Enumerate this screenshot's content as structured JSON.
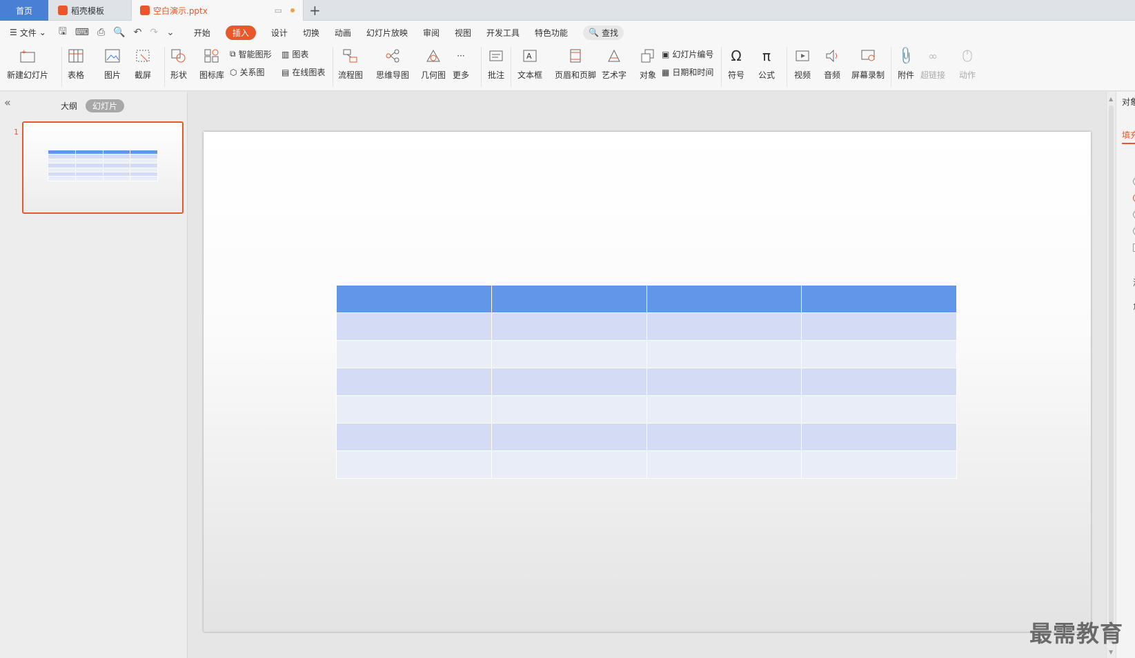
{
  "tabs": {
    "home": "首页",
    "template": "稻壳模板",
    "doc": "空白演示.pptx"
  },
  "menubar": {
    "file": "文件",
    "items": [
      "开始",
      "插入",
      "设计",
      "切换",
      "动画",
      "幻灯片放映",
      "审阅",
      "视图",
      "开发工具",
      "特色功能"
    ],
    "active": "插入",
    "search": "查找"
  },
  "ribbon": {
    "new_slide": "新建幻灯片",
    "table": "表格",
    "picture": "图片",
    "screenshot": "截屏",
    "shape": "形状",
    "icon_lib": "图标库",
    "smart_art": "智能图形",
    "chart": "图表",
    "relation": "关系图",
    "online_chart": "在线图表",
    "flowchart": "流程图",
    "mindmap": "思维导图",
    "geometry": "几何图",
    "more": "更多",
    "comment": "批注",
    "textbox": "文本框",
    "header_footer": "页眉和页脚",
    "wordart": "艺术字",
    "object": "对象",
    "slide_number": "幻灯片编号",
    "date_time": "日期和时间",
    "symbol": "符号",
    "formula": "公式",
    "video": "视频",
    "audio": "音频",
    "screen_record": "屏幕录制",
    "attachment": "附件",
    "hyperlink": "超链接",
    "action": "动作"
  },
  "leftpanel": {
    "outline": "大纲",
    "slides": "幻灯片",
    "slide_number": "1"
  },
  "slide_table": {
    "rows": 7,
    "cols": 4,
    "header_color": "#6296e8",
    "band_a": "#d4dcf5",
    "band_b": "#e9edf8"
  },
  "rightpanel": {
    "title": "对象属性",
    "fill_tab": "填充",
    "opt1": "渐",
    "opt2": "角"
  },
  "watermark": "最需教育",
  "colors": {
    "accent": "#e8582a",
    "home_tab": "#4a7fd6"
  }
}
